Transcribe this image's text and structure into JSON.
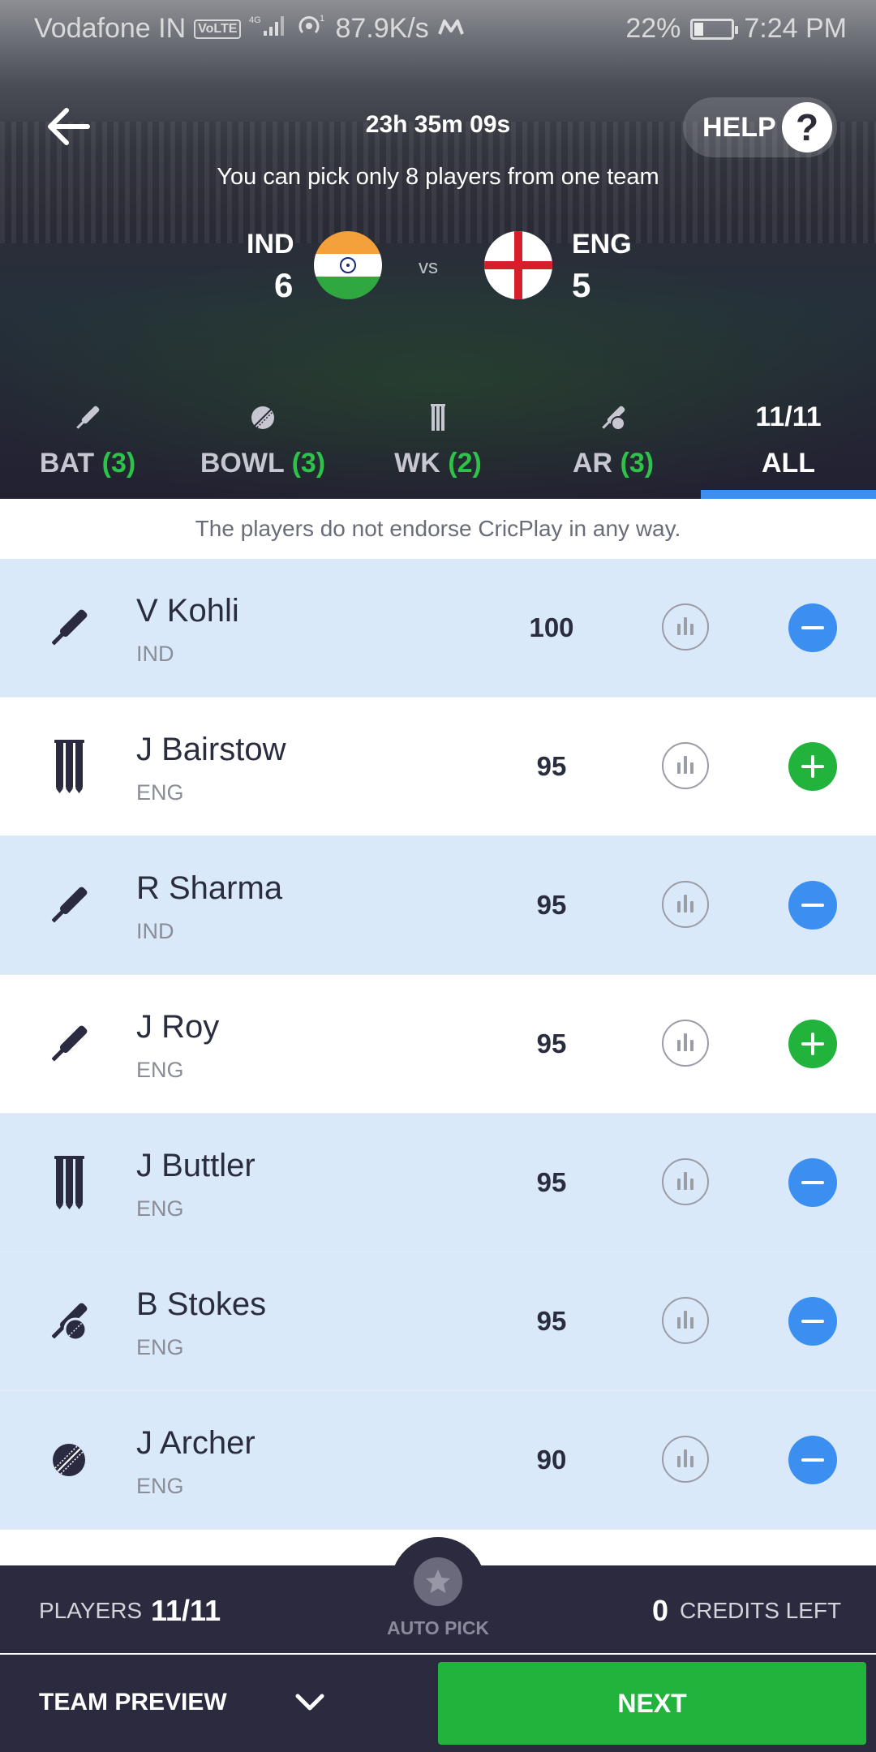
{
  "status_bar": {
    "carrier": "Vodafone IN",
    "volte": "VoLTE",
    "network": "4G",
    "speed": "87.9K/s",
    "battery": "22%",
    "time": "7:24 PM"
  },
  "header": {
    "timer": "23h 35m 09s",
    "help_label": "HELP",
    "help_icon_glyph": "?",
    "notice": "You can pick only 8 players from one team"
  },
  "match": {
    "team1": {
      "name": "IND",
      "count": "6"
    },
    "vs": "vs",
    "team2": {
      "name": "ENG",
      "count": "5"
    }
  },
  "tabs": [
    {
      "label": "BAT",
      "count": "(3)",
      "icon": "bat-icon"
    },
    {
      "label": "BOWL",
      "count": "(3)",
      "icon": "ball-icon"
    },
    {
      "label": "WK",
      "count": "(2)",
      "icon": "stumps-icon"
    },
    {
      "label": "AR",
      "count": "(3)",
      "icon": "allrounder-icon"
    },
    {
      "label": "ALL",
      "ratio": "11/11",
      "active": true
    }
  ],
  "disclaimer": "The players do not endorse CricPlay in any way.",
  "players": [
    {
      "name": "V Kohli",
      "team": "IND",
      "credits": "100",
      "role_icon": "bat-icon",
      "selected": true
    },
    {
      "name": "J Bairstow",
      "team": "ENG",
      "credits": "95",
      "role_icon": "stumps-icon",
      "selected": false
    },
    {
      "name": "R Sharma",
      "team": "IND",
      "credits": "95",
      "role_icon": "bat-icon",
      "selected": true
    },
    {
      "name": "J Roy",
      "team": "ENG",
      "credits": "95",
      "role_icon": "bat-icon",
      "selected": false
    },
    {
      "name": "J Buttler",
      "team": "ENG",
      "credits": "95",
      "role_icon": "stumps-icon",
      "selected": true
    },
    {
      "name": "B Stokes",
      "team": "ENG",
      "credits": "95",
      "role_icon": "allrounder-icon",
      "selected": true
    },
    {
      "name": "J Archer",
      "team": "ENG",
      "credits": "90",
      "role_icon": "ball-icon",
      "selected": true
    }
  ],
  "footer": {
    "players_label": "PLAYERS",
    "players_value": "11/11",
    "auto_pick_label": "AUTO PICK",
    "credits_value": "0",
    "credits_label": "CREDITS LEFT",
    "team_preview_label": "TEAM PREVIEW",
    "next_label": "NEXT"
  },
  "colors": {
    "selected_row": "#dae9fa",
    "remove_button": "#3b8ff0",
    "add_button": "#22b33d",
    "footer_bg": "#2b2a3e",
    "count_green": "#2ec24a"
  }
}
